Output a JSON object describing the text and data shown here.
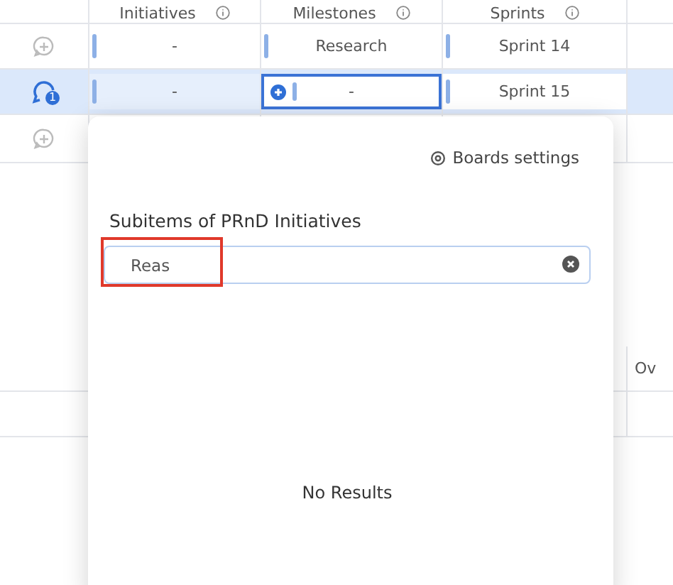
{
  "table": {
    "columns": [
      {
        "label": "Initiatives"
      },
      {
        "label": "Milestones"
      },
      {
        "label": "Sprints"
      }
    ],
    "rows": [
      {
        "selected": false,
        "update_count": "",
        "initiative": "-",
        "milestone": "Research",
        "sprint": "Sprint 14",
        "focused": false
      },
      {
        "selected": true,
        "update_count": "1",
        "initiative": "-",
        "milestone": "-",
        "sprint": "Sprint 15",
        "focused": true
      },
      {
        "selected": false,
        "update_count": "",
        "initiative": "",
        "milestone": "",
        "sprint": ""
      }
    ],
    "lower_rows": [
      {
        "column_4": "Ov"
      },
      {
        "column_4": ""
      }
    ]
  },
  "popup": {
    "settings_link": "Boards settings",
    "title": "Subitems of PRnD Initiatives",
    "search": {
      "value": "Reas",
      "highlighted": true
    },
    "empty_message": "No Results"
  }
}
